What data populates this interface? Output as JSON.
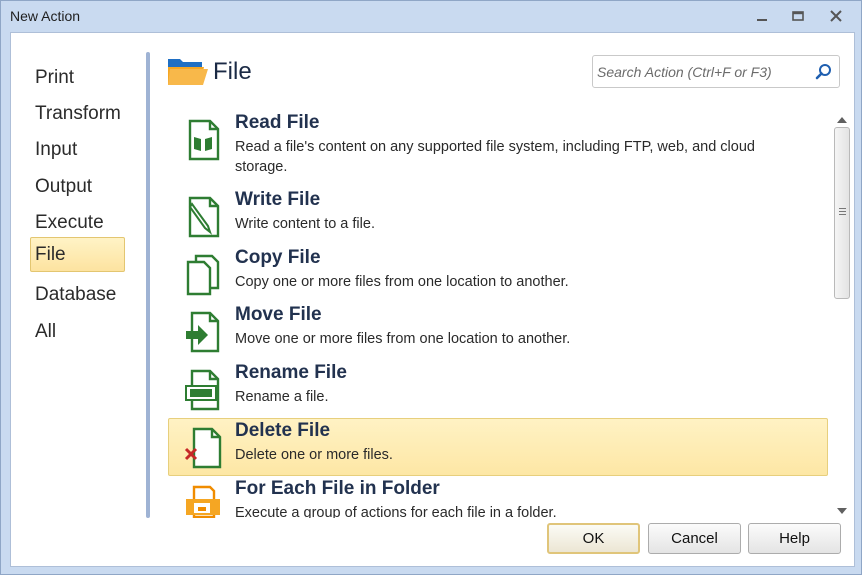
{
  "window": {
    "title": "New Action",
    "controls": {
      "minimize": "minimize-icon",
      "maximize": "maximize-icon",
      "close": "close-icon"
    }
  },
  "nav": {
    "items": [
      {
        "label": "Print",
        "selected": false
      },
      {
        "label": "Transform",
        "selected": false
      },
      {
        "label": "Input",
        "selected": false
      },
      {
        "label": "Output",
        "selected": false
      },
      {
        "label": "Execute",
        "selected": false
      },
      {
        "label": "File",
        "selected": true
      },
      {
        "label": "Database",
        "selected": false
      },
      {
        "label": "All",
        "selected": false
      }
    ]
  },
  "header": {
    "title": "File",
    "icon": "open-folder-icon"
  },
  "search": {
    "placeholder": "Search Action (Ctrl+F or F3)",
    "icon": "search-icon"
  },
  "actions": [
    {
      "title": "Read File",
      "desc": "Read a file's content on any supported file system, including FTP, web, and cloud storage.",
      "icon": "read-file-icon",
      "selected": false
    },
    {
      "title": "Write File",
      "desc": "Write content to a file.",
      "icon": "write-file-icon",
      "selected": false
    },
    {
      "title": "Copy File",
      "desc": "Copy one or more files from one location to another.",
      "icon": "copy-file-icon",
      "selected": false
    },
    {
      "title": "Move File",
      "desc": "Move one or more files from one location to another.",
      "icon": "move-file-icon",
      "selected": false
    },
    {
      "title": "Rename File",
      "desc": "Rename a file.",
      "icon": "rename-file-icon",
      "selected": false
    },
    {
      "title": "Delete File",
      "desc": "Delete one or more files.",
      "icon": "delete-file-icon",
      "selected": true
    },
    {
      "title": "For Each File in Folder",
      "desc": "Execute a group of actions for each file in a folder.",
      "icon": "for-each-file-icon",
      "selected": false
    }
  ],
  "buttons": {
    "ok": "OK",
    "cancel": "Cancel",
    "help": "Help"
  },
  "colors": {
    "window_frame": "#c9daf0",
    "selection_fill": "#fde7a5",
    "selection_border": "#e7cf7d",
    "icon_green": "#2e7d32",
    "folder_orange": "#f5a623",
    "folder_blue": "#1f6fc4",
    "delete_red": "#c62828"
  }
}
